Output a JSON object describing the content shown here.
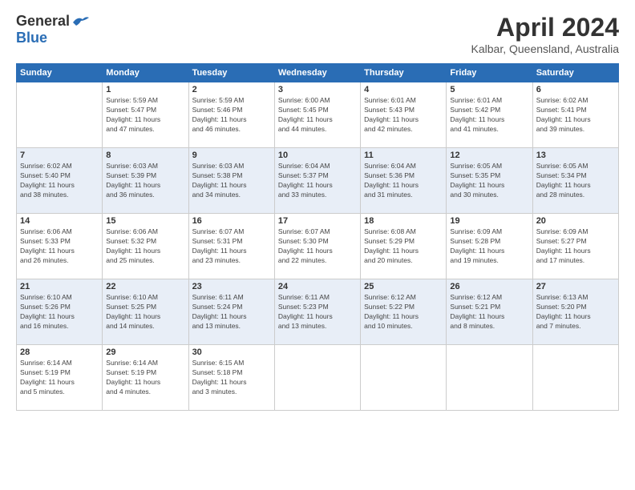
{
  "header": {
    "logo": {
      "general": "General",
      "blue": "Blue"
    },
    "title": "April 2024",
    "location": "Kalbar, Queensland, Australia"
  },
  "calendar": {
    "days_of_week": [
      "Sunday",
      "Monday",
      "Tuesday",
      "Wednesday",
      "Thursday",
      "Friday",
      "Saturday"
    ],
    "weeks": [
      [
        {
          "day": "",
          "info": ""
        },
        {
          "day": "1",
          "info": "Sunrise: 5:59 AM\nSunset: 5:47 PM\nDaylight: 11 hours\nand 47 minutes."
        },
        {
          "day": "2",
          "info": "Sunrise: 5:59 AM\nSunset: 5:46 PM\nDaylight: 11 hours\nand 46 minutes."
        },
        {
          "day": "3",
          "info": "Sunrise: 6:00 AM\nSunset: 5:45 PM\nDaylight: 11 hours\nand 44 minutes."
        },
        {
          "day": "4",
          "info": "Sunrise: 6:01 AM\nSunset: 5:43 PM\nDaylight: 11 hours\nand 42 minutes."
        },
        {
          "day": "5",
          "info": "Sunrise: 6:01 AM\nSunset: 5:42 PM\nDaylight: 11 hours\nand 41 minutes."
        },
        {
          "day": "6",
          "info": "Sunrise: 6:02 AM\nSunset: 5:41 PM\nDaylight: 11 hours\nand 39 minutes."
        }
      ],
      [
        {
          "day": "7",
          "info": ""
        },
        {
          "day": "8",
          "info": "Sunrise: 6:03 AM\nSunset: 5:39 PM\nDaylight: 11 hours\nand 36 minutes."
        },
        {
          "day": "9",
          "info": "Sunrise: 6:03 AM\nSunset: 5:38 PM\nDaylight: 11 hours\nand 34 minutes."
        },
        {
          "day": "10",
          "info": "Sunrise: 6:04 AM\nSunset: 5:37 PM\nDaylight: 11 hours\nand 33 minutes."
        },
        {
          "day": "11",
          "info": "Sunrise: 6:04 AM\nSunset: 5:36 PM\nDaylight: 11 hours\nand 31 minutes."
        },
        {
          "day": "12",
          "info": "Sunrise: 6:05 AM\nSunset: 5:35 PM\nDaylight: 11 hours\nand 30 minutes."
        },
        {
          "day": "13",
          "info": "Sunrise: 6:05 AM\nSunset: 5:34 PM\nDaylight: 11 hours\nand 28 minutes."
        }
      ],
      [
        {
          "day": "14",
          "info": ""
        },
        {
          "day": "15",
          "info": "Sunrise: 6:06 AM\nSunset: 5:32 PM\nDaylight: 11 hours\nand 25 minutes."
        },
        {
          "day": "16",
          "info": "Sunrise: 6:07 AM\nSunset: 5:31 PM\nDaylight: 11 hours\nand 23 minutes."
        },
        {
          "day": "17",
          "info": "Sunrise: 6:07 AM\nSunset: 5:30 PM\nDaylight: 11 hours\nand 22 minutes."
        },
        {
          "day": "18",
          "info": "Sunrise: 6:08 AM\nSunset: 5:29 PM\nDaylight: 11 hours\nand 20 minutes."
        },
        {
          "day": "19",
          "info": "Sunrise: 6:09 AM\nSunset: 5:28 PM\nDaylight: 11 hours\nand 19 minutes."
        },
        {
          "day": "20",
          "info": "Sunrise: 6:09 AM\nSunset: 5:27 PM\nDaylight: 11 hours\nand 17 minutes."
        }
      ],
      [
        {
          "day": "21",
          "info": ""
        },
        {
          "day": "22",
          "info": "Sunrise: 6:10 AM\nSunset: 5:25 PM\nDaylight: 11 hours\nand 14 minutes."
        },
        {
          "day": "23",
          "info": "Sunrise: 6:11 AM\nSunset: 5:24 PM\nDaylight: 11 hours\nand 13 minutes."
        },
        {
          "day": "24",
          "info": "Sunrise: 6:11 AM\nSunset: 5:23 PM\nDaylight: 11 hours\nand 13 minutes."
        },
        {
          "day": "25",
          "info": "Sunrise: 6:12 AM\nSunset: 5:22 PM\nDaylight: 11 hours\nand 10 minutes."
        },
        {
          "day": "26",
          "info": "Sunrise: 6:12 AM\nSunset: 5:21 PM\nDaylight: 11 hours\nand 8 minutes."
        },
        {
          "day": "27",
          "info": "Sunrise: 6:13 AM\nSunset: 5:20 PM\nDaylight: 11 hours\nand 7 minutes."
        }
      ],
      [
        {
          "day": "28",
          "info": "Sunrise: 6:14 AM\nSunset: 5:19 PM\nDaylight: 11 hours\nand 5 minutes."
        },
        {
          "day": "29",
          "info": "Sunrise: 6:14 AM\nSunset: 5:19 PM\nDaylight: 11 hours\nand 4 minutes."
        },
        {
          "day": "30",
          "info": "Sunrise: 6:15 AM\nSunset: 5:18 PM\nDaylight: 11 hours\nand 3 minutes."
        },
        {
          "day": "",
          "info": ""
        },
        {
          "day": "",
          "info": ""
        },
        {
          "day": "",
          "info": ""
        },
        {
          "day": "",
          "info": ""
        }
      ]
    ]
  }
}
